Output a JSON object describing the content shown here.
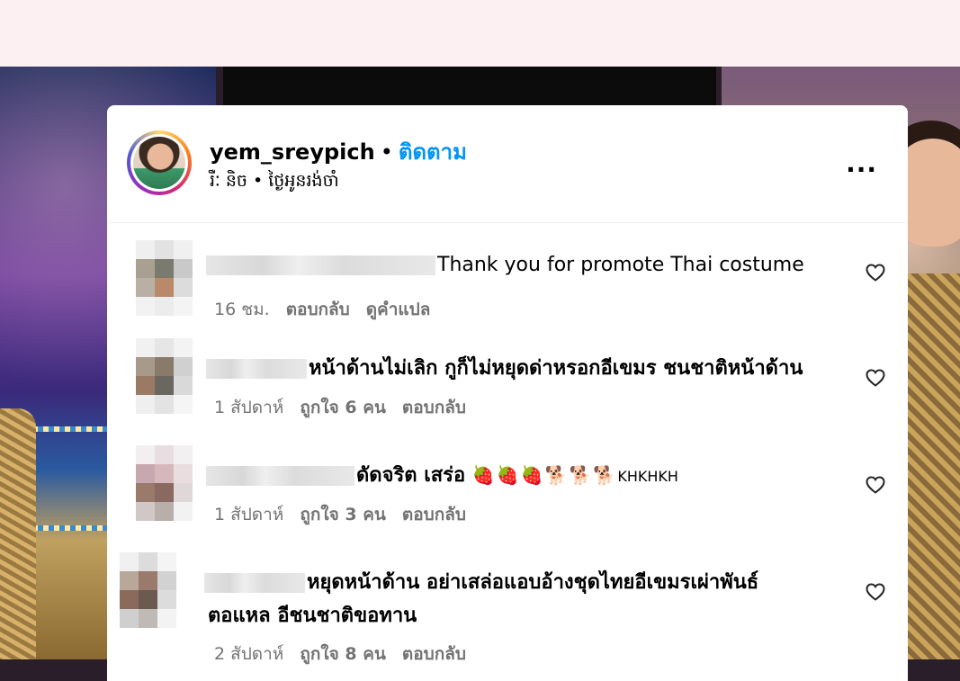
{
  "post": {
    "username": "yem_sreypich",
    "separator": "•",
    "follow_label": "ติดตาม",
    "subtitle": "រឺៈ និច • ថ្ងៃអូនរង់ចាំ",
    "more_label": "..."
  },
  "comments": [
    {
      "text": "Thank you for promote Thai costume",
      "time": "16 ชม.",
      "reply_label": "ตอบกลับ",
      "translate_label": "ดูคำแปล"
    },
    {
      "text": "หน้าด้านไม่เลิก กูก็ไม่หยุดด่าหรอกอีเขมร ชนชาติหน้าด้าน",
      "time": "1 สัปดาห์",
      "likes_label": "ถูกใจ 6 คน",
      "reply_label": "ตอบกลับ"
    },
    {
      "text": "ดัดจริต เสร่อ",
      "emoji_strawberry": "🍓",
      "emoji_dog": "🐕",
      "suffix": "KHKHKH",
      "time": "1 สัปดาห์",
      "likes_label": "ถูกใจ 3 คน",
      "reply_label": "ตอบกลับ"
    },
    {
      "text": "หยุดหน้าด้าน อย่าเสล่อแอบอ้างชุดไทยอีเขมรเผ่าพันธ์",
      "text_line2": "ตอแหล อีชนชาติขอทาน",
      "time": "2 สัปดาห์",
      "likes_label": "ถูกใจ 8 คน",
      "reply_label": "ตอบกลับ"
    }
  ],
  "icons": {
    "heart": "heart-outline-icon",
    "more": "more-options-icon"
  },
  "colors": {
    "follow": "#0095f6",
    "meta": "#737373",
    "topbar": "#fdf0f3"
  }
}
